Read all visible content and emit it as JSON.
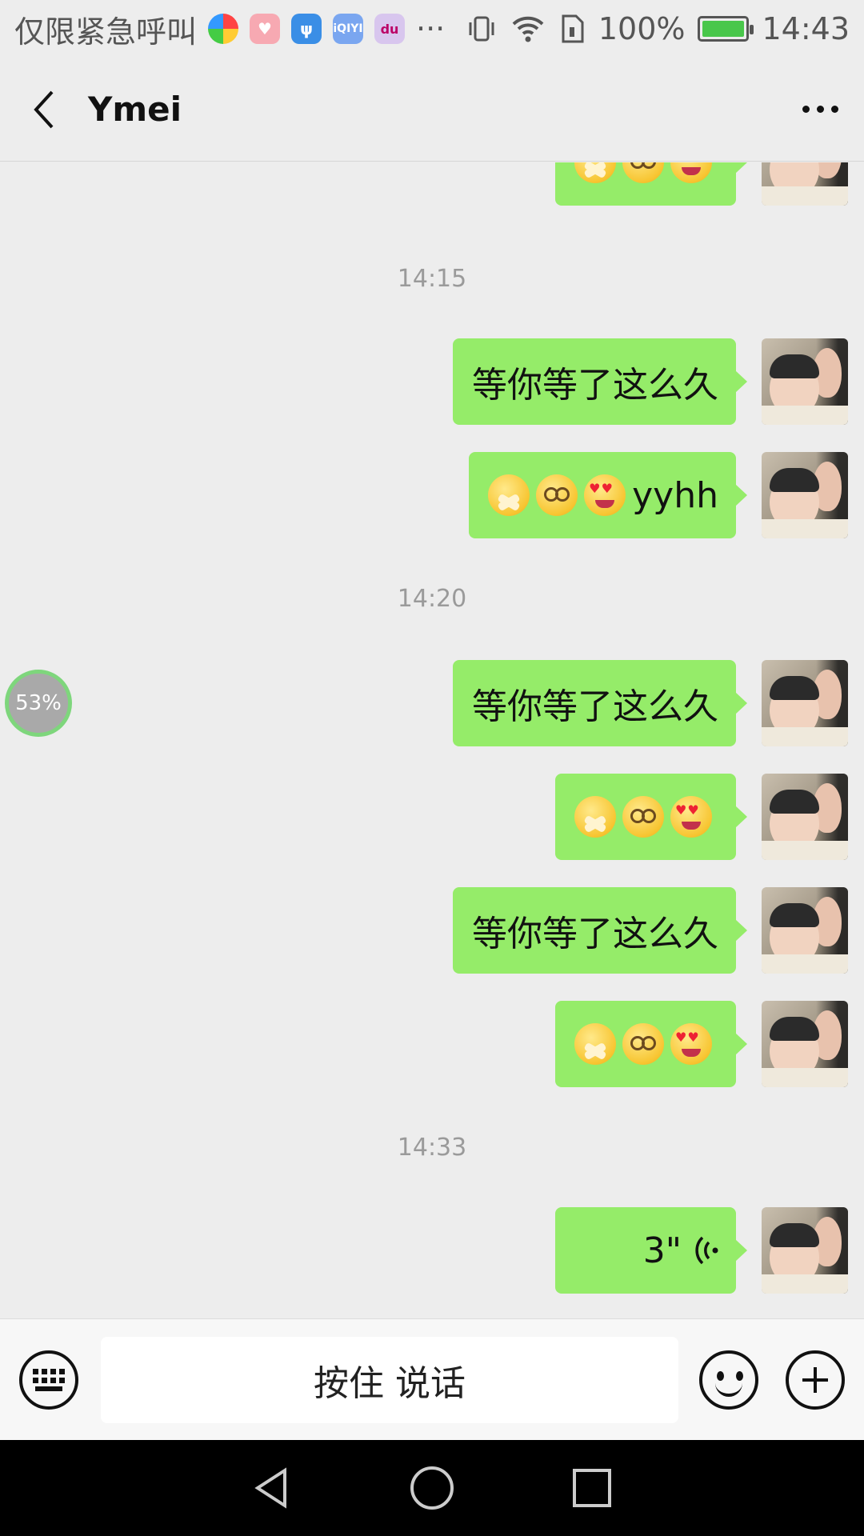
{
  "status_bar": {
    "carrier": "仅限紧急呼叫",
    "overflow": "···",
    "battery_level": "100%",
    "time": "14:43",
    "app_icons": [
      "browser-icon",
      "heart-app-icon",
      "usb-icon",
      "iqiyi-icon",
      "baidu-icon"
    ],
    "usb_glyph": "ψ",
    "iqiyi_glyph": "iQIYI",
    "baidu_glyph": "du"
  },
  "header": {
    "title": "Ymei"
  },
  "chat": {
    "messages": [
      {
        "type": "emoji",
        "emojis": [
          "hush",
          "dizzy",
          "love"
        ]
      },
      {
        "type": "time",
        "text": "14:15"
      },
      {
        "type": "text",
        "text": "等你等了这么久"
      },
      {
        "type": "emoji_text",
        "emojis": [
          "hush",
          "dizzy",
          "love"
        ],
        "text": "yyhh"
      },
      {
        "type": "time",
        "text": "14:20"
      },
      {
        "type": "text",
        "text": "等你等了这么久"
      },
      {
        "type": "emoji",
        "emojis": [
          "hush",
          "dizzy",
          "love"
        ]
      },
      {
        "type": "text",
        "text": "等你等了这么久"
      },
      {
        "type": "emoji",
        "emojis": [
          "hush",
          "dizzy",
          "love"
        ]
      },
      {
        "type": "time",
        "text": "14:33"
      },
      {
        "type": "voice",
        "duration": "3\"",
        "icon": "voice-wave-icon"
      }
    ],
    "progress_overlay": "53%"
  },
  "input_bar": {
    "hold_to_talk": "按住 说话"
  },
  "colors": {
    "bubble_self": "#95ec69",
    "background": "#ededed",
    "nav_bar": "#000000"
  }
}
